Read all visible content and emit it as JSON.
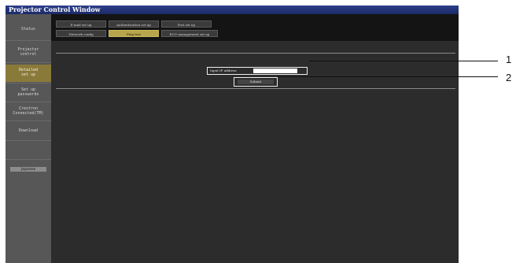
{
  "window": {
    "title": "Projector Control Window"
  },
  "sidebar": {
    "items": [
      {
        "label": "Status"
      },
      {
        "label": "Projector\ncontrol"
      },
      {
        "label": "Detailed\nset up"
      },
      {
        "label": "Set up\npasswords"
      },
      {
        "label": "Crestron\nConnected(TM)"
      },
      {
        "label": "Download"
      }
    ],
    "language_button": "Japanese"
  },
  "tabs": [
    {
      "label": "E-mail set up"
    },
    {
      "label": "Authentication set up"
    },
    {
      "label": "Port set up"
    },
    {
      "label": "Network config"
    },
    {
      "label": "Ping test"
    },
    {
      "label": "ECO management set up"
    }
  ],
  "form": {
    "ip_label": "Input IP address",
    "ip_value": "",
    "submit_label": "Submit"
  },
  "callouts": {
    "one": "1",
    "two": "2"
  },
  "colors": {
    "active_tab": "#b7a64b",
    "active_side": "#8a7a3a",
    "title_bar": "#2d3f8a"
  }
}
